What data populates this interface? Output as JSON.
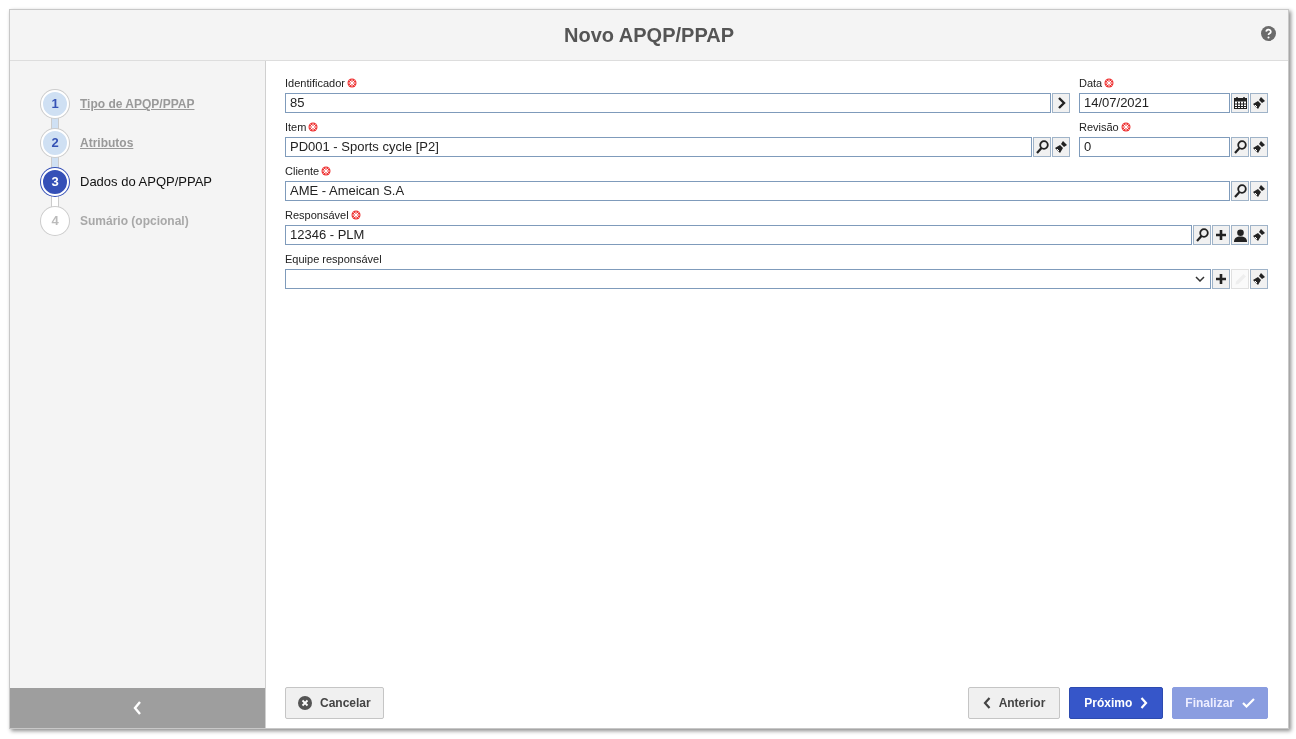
{
  "window": {
    "title": "Novo APQP/PPAP"
  },
  "steps": [
    {
      "number": "1",
      "label": "Tipo de APQP/PPAP",
      "completed": true,
      "selected": false
    },
    {
      "number": "2",
      "label": "Atributos",
      "completed": true,
      "selected": false
    },
    {
      "number": "3",
      "label": "Dados do APQP/PPAP",
      "completed": false,
      "selected": true
    },
    {
      "number": "4",
      "label": "Sumário (opcional)",
      "completed": false,
      "selected": false
    }
  ],
  "form": {
    "rows": [
      {
        "fields": [
          {
            "label": "Identificador",
            "required": true,
            "kind": "text",
            "value": "85",
            "buttons": [
              {
                "kind": "next",
                "disabled": false
              }
            ]
          },
          {
            "label": "Data",
            "required": true,
            "kind": "text",
            "value": "14/07/2021",
            "buttons": [
              {
                "kind": "calendar",
                "disabled": false
              },
              {
                "kind": "clear",
                "disabled": false
              }
            ]
          }
        ]
      },
      {
        "fields": [
          {
            "label": "Item",
            "required": true,
            "kind": "text",
            "value": "PD001 - Sports cycle [P2]",
            "buttons": [
              {
                "kind": "search",
                "disabled": false
              },
              {
                "kind": "clear",
                "disabled": false
              }
            ]
          },
          {
            "label": "Revisão",
            "required": true,
            "kind": "text",
            "value": "0",
            "buttons": [
              {
                "kind": "search",
                "disabled": false
              },
              {
                "kind": "clear",
                "disabled": false
              }
            ]
          }
        ]
      },
      {
        "fields": [
          {
            "label": "Cliente",
            "required": true,
            "kind": "text",
            "value": "AME - Ameican S.A",
            "buttons": [
              {
                "kind": "search",
                "disabled": false
              },
              {
                "kind": "clear",
                "disabled": false
              }
            ]
          }
        ]
      },
      {
        "fields": [
          {
            "label": "Responsável",
            "required": true,
            "kind": "text",
            "value": "12346 - PLM",
            "buttons": [
              {
                "kind": "search",
                "disabled": false
              },
              {
                "kind": "add",
                "disabled": false
              },
              {
                "kind": "user",
                "disabled": false
              },
              {
                "kind": "clear",
                "disabled": false
              }
            ]
          }
        ]
      },
      {
        "fields": [
          {
            "label": "Equipe responsável",
            "required": false,
            "kind": "select",
            "buttons": [
              {
                "kind": "add",
                "disabled": false
              },
              {
                "kind": "edit",
                "disabled": true
              },
              {
                "kind": "clear",
                "disabled": false
              }
            ]
          }
        ]
      }
    ]
  },
  "buttons": [
    {
      "label": "Cancelar",
      "kind": "cancel",
      "disabled": false
    },
    {
      "label": "Anterior",
      "kind": "previous",
      "disabled": false
    },
    {
      "label": "Próximo",
      "kind": "next",
      "disabled": false
    },
    {
      "label": "Finalizar",
      "kind": "finish",
      "disabled": true
    }
  ]
}
